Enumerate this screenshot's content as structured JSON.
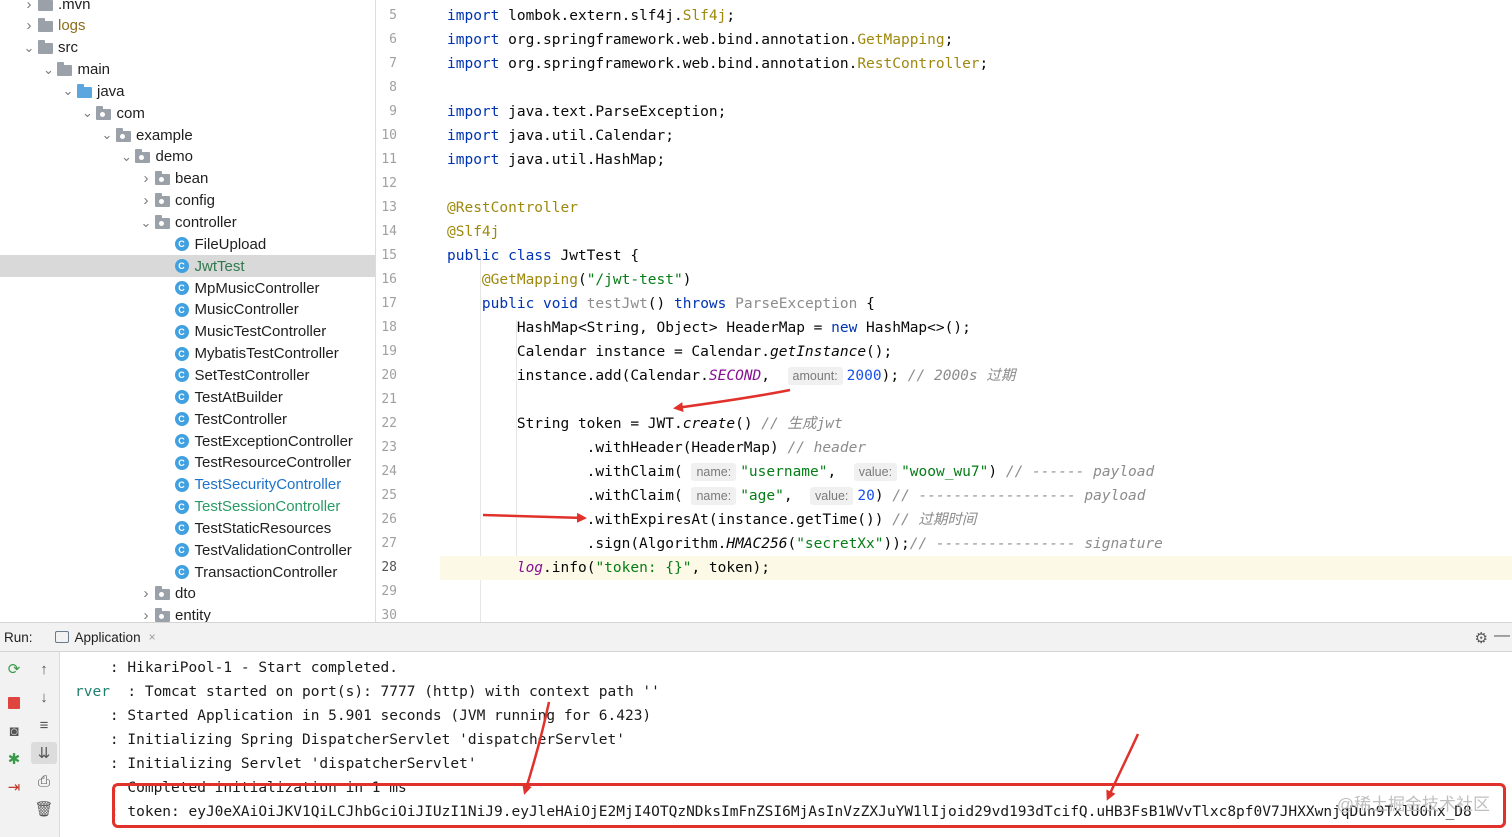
{
  "project_tree": {
    "items": [
      {
        "label": ".mvn",
        "depth": 0,
        "expanded": false,
        "kind": "folder"
      },
      {
        "label": "logs",
        "depth": 0,
        "expanded": false,
        "kind": "folder"
      },
      {
        "label": "src",
        "depth": 0,
        "expanded": true,
        "kind": "folder"
      },
      {
        "label": "main",
        "depth": 1,
        "expanded": true,
        "kind": "folder"
      },
      {
        "label": "java",
        "depth": 2,
        "expanded": true,
        "kind": "source-folder"
      },
      {
        "label": "com",
        "depth": 3,
        "expanded": true,
        "kind": "package"
      },
      {
        "label": "example",
        "depth": 4,
        "expanded": true,
        "kind": "package"
      },
      {
        "label": "demo",
        "depth": 5,
        "expanded": true,
        "kind": "package"
      },
      {
        "label": "bean",
        "depth": 6,
        "expanded": false,
        "kind": "package"
      },
      {
        "label": "config",
        "depth": 6,
        "expanded": false,
        "kind": "package"
      },
      {
        "label": "controller",
        "depth": 6,
        "expanded": true,
        "kind": "package"
      },
      {
        "label": "FileUpload",
        "depth": 7,
        "kind": "class"
      },
      {
        "label": "JwtTest",
        "depth": 7,
        "kind": "class",
        "selected": true
      },
      {
        "label": "MpMusicController",
        "depth": 7,
        "kind": "class"
      },
      {
        "label": "MusicController",
        "depth": 7,
        "kind": "class"
      },
      {
        "label": "MusicTestController",
        "depth": 7,
        "kind": "class"
      },
      {
        "label": "MybatisTestController",
        "depth": 7,
        "kind": "class"
      },
      {
        "label": "SetTestController",
        "depth": 7,
        "kind": "class"
      },
      {
        "label": "TestAtBuilder",
        "depth": 7,
        "kind": "class"
      },
      {
        "label": "TestController",
        "depth": 7,
        "kind": "class"
      },
      {
        "label": "TestExceptionController",
        "depth": 7,
        "kind": "class"
      },
      {
        "label": "TestResourceController",
        "depth": 7,
        "kind": "class"
      },
      {
        "label": "TestSecurityController",
        "depth": 7,
        "kind": "class",
        "vcs": "modified"
      },
      {
        "label": "TestSessionController",
        "depth": 7,
        "kind": "class",
        "vcs": "added"
      },
      {
        "label": "TestStaticResources",
        "depth": 7,
        "kind": "class"
      },
      {
        "label": "TestValidationController",
        "depth": 7,
        "kind": "class"
      },
      {
        "label": "TransactionController",
        "depth": 7,
        "kind": "class"
      },
      {
        "label": "dto",
        "depth": 6,
        "expanded": false,
        "kind": "package"
      },
      {
        "label": "entity",
        "depth": 6,
        "expanded": false,
        "kind": "package"
      }
    ]
  },
  "editor": {
    "current_line": "28",
    "lines": [
      {
        "n": "5",
        "t": [
          [
            "kw",
            "import"
          ],
          [
            "p",
            " lombok.extern.slf4j."
          ],
          [
            "ann",
            "Slf4j"
          ],
          [
            "p",
            ";"
          ]
        ]
      },
      {
        "n": "6",
        "t": [
          [
            "kw",
            "import"
          ],
          [
            "p",
            " org.springframework.web.bind.annotation."
          ],
          [
            "ann",
            "GetMapping"
          ],
          [
            "p",
            ";"
          ]
        ]
      },
      {
        "n": "7",
        "t": [
          [
            "kw",
            "import"
          ],
          [
            "p",
            " org.springframework.web.bind.annotation."
          ],
          [
            "ann",
            "RestController"
          ],
          [
            "p",
            ";"
          ]
        ]
      },
      {
        "n": "8",
        "t": []
      },
      {
        "n": "9",
        "t": [
          [
            "kw",
            "import"
          ],
          [
            "p",
            " java.text.ParseException;"
          ]
        ]
      },
      {
        "n": "10",
        "t": [
          [
            "kw",
            "import"
          ],
          [
            "p",
            " java.util.Calendar;"
          ]
        ]
      },
      {
        "n": "11",
        "t": [
          [
            "kw",
            "import"
          ],
          [
            "p",
            " java.util.HashMap;"
          ]
        ]
      },
      {
        "n": "12",
        "t": []
      },
      {
        "n": "13",
        "t": [
          [
            "ann",
            "@RestController"
          ]
        ]
      },
      {
        "n": "14",
        "t": [
          [
            "ann",
            "@Slf4j"
          ]
        ]
      },
      {
        "n": "15",
        "t": [
          [
            "kw",
            "public class"
          ],
          [
            "p",
            " JwtTest {"
          ]
        ]
      },
      {
        "n": "16",
        "t": [
          [
            "p",
            "    "
          ],
          [
            "ann",
            "@GetMapping"
          ],
          [
            "p",
            "("
          ],
          [
            "str",
            "\"/jwt-test\""
          ],
          [
            "p",
            ")"
          ]
        ]
      },
      {
        "n": "17",
        "t": [
          [
            "p",
            "    "
          ],
          [
            "kw",
            "public void"
          ],
          [
            "p",
            " "
          ],
          [
            "gry",
            "testJwt"
          ],
          [
            "p",
            "() "
          ],
          [
            "kw",
            "throws"
          ],
          [
            "p",
            " "
          ],
          [
            "gry",
            "ParseException"
          ],
          [
            "p",
            " {"
          ]
        ]
      },
      {
        "n": "18",
        "t": [
          [
            "p",
            "        HashMap<String, Object> HeaderMap = "
          ],
          [
            "kw",
            "new"
          ],
          [
            "p",
            " HashMap<>();"
          ]
        ]
      },
      {
        "n": "19",
        "t": [
          [
            "p",
            "        Calendar instance = Calendar."
          ],
          [
            "ital",
            "getInstance"
          ],
          [
            "p",
            "();"
          ]
        ]
      },
      {
        "n": "20",
        "t": [
          [
            "p",
            "        instance.add(Calendar."
          ],
          [
            "fld",
            "SECOND"
          ],
          [
            "p",
            ",  "
          ],
          [
            "hint",
            "amount:"
          ],
          [
            "num",
            "2000"
          ],
          [
            "p",
            "); "
          ],
          [
            "cm",
            "// 2000s 过期"
          ]
        ]
      },
      {
        "n": "21",
        "t": []
      },
      {
        "n": "22",
        "t": [
          [
            "p",
            "        String token = JWT."
          ],
          [
            "ital",
            "create"
          ],
          [
            "p",
            "() "
          ],
          [
            "cm",
            "// 生成jwt"
          ]
        ]
      },
      {
        "n": "23",
        "t": [
          [
            "p",
            "                .withHeader(HeaderMap) "
          ],
          [
            "cm",
            "// header"
          ]
        ]
      },
      {
        "n": "24",
        "t": [
          [
            "p",
            "                .withClaim( "
          ],
          [
            "hint",
            "name:"
          ],
          [
            "str",
            "\"username\""
          ],
          [
            "p",
            ",  "
          ],
          [
            "hint",
            "value:"
          ],
          [
            "str",
            "\"woow_wu7\""
          ],
          [
            "p",
            ") "
          ],
          [
            "cm",
            "// ------ payload"
          ]
        ]
      },
      {
        "n": "25",
        "t": [
          [
            "p",
            "                .withClaim( "
          ],
          [
            "hint",
            "name:"
          ],
          [
            "str",
            "\"age\""
          ],
          [
            "p",
            ",  "
          ],
          [
            "hint",
            "value:"
          ],
          [
            "num",
            "20"
          ],
          [
            "p",
            ") "
          ],
          [
            "cm",
            "// ------------------ payload"
          ]
        ]
      },
      {
        "n": "26",
        "t": [
          [
            "p",
            "                .withExpiresAt(instance.getTime()) "
          ],
          [
            "cm",
            "// 过期时间"
          ]
        ]
      },
      {
        "n": "27",
        "t": [
          [
            "p",
            "                .sign(Algorithm."
          ],
          [
            "ital",
            "HMAC256"
          ],
          [
            "p",
            "("
          ],
          [
            "str",
            "\"secretXx\""
          ],
          [
            "p",
            "));"
          ],
          [
            "cm",
            "// ---------------- signature"
          ]
        ]
      },
      {
        "n": "28",
        "t": [
          [
            "p",
            "        "
          ],
          [
            "fld",
            "log"
          ],
          [
            "p",
            ".info("
          ],
          [
            "str",
            "\"token: {}\""
          ],
          [
            "p",
            ", token);"
          ]
        ]
      },
      {
        "n": "29",
        "t": []
      },
      {
        "n": "30",
        "t": []
      }
    ]
  },
  "run_panel": {
    "label": "Run:",
    "tab_label": "Application",
    "tab_close": "×",
    "icons": [
      "rerun-icon",
      "stop-icon",
      "screenshot-icon",
      "debug-bug-icon",
      "exit-icon",
      "up-arrow-icon",
      "down-arrow-icon",
      "soft-wrap-icon",
      "scroll-to-end-icon",
      "print-icon",
      "trash-icon",
      "gear-icon",
      "minimize-icon"
    ],
    "console_lines": [
      {
        "logger": "",
        "text": "    : HikariPool-1 - Start completed."
      },
      {
        "logger": "rver",
        "text": "  : Tomcat started on port(s): 7777 (http) with context path ''"
      },
      {
        "logger": "",
        "text": "    : Started Application in 5.901 seconds (JVM running for 6.423)"
      },
      {
        "logger": "",
        "text": "    : Initializing Spring DispatcherServlet 'dispatcherServlet'"
      },
      {
        "logger": "",
        "text": "    : Initializing Servlet 'dispatcherServlet'"
      },
      {
        "logger": "",
        "text": "    : Completed initialization in 1 ms"
      },
      {
        "logger": "",
        "text": "    : token: eyJ0eXAiOiJKV1QiLCJhbGciOiJIUzI1NiJ9.eyJleHAiOjE2MjI4OTQzNDksImFnZSI6MjAsInVzZXJuYW1lIjoid29vd193dTcifQ.uHB3FsB1WVvTlxc8pf0V7JHXXwnjqDuh9TxlU0hx_D8"
      }
    ]
  },
  "watermark": "@稀土掘金技术社区",
  "annotation_color": "#e0312b"
}
